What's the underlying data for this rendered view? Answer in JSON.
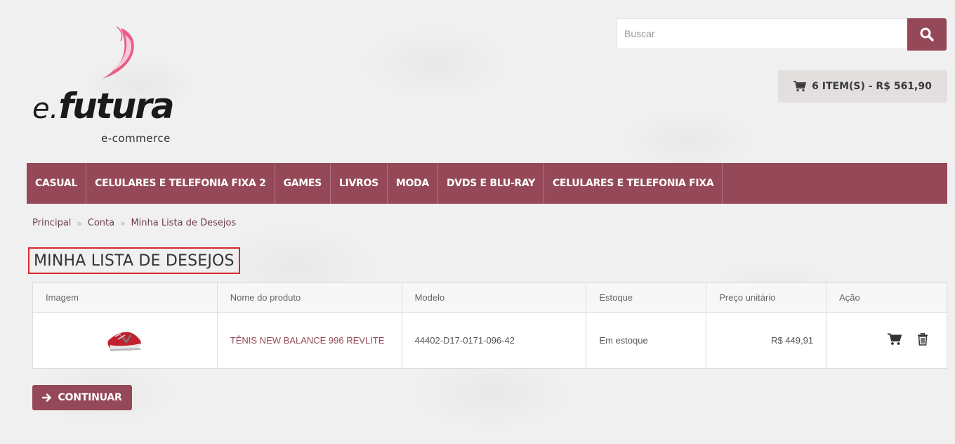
{
  "logo": {
    "prefix": "e.",
    "name": "futura",
    "tagline": "e-commerce"
  },
  "search": {
    "placeholder": "Buscar",
    "icon": "search-icon"
  },
  "cart": {
    "label": "6 ITEM(S) - R$ 561,90",
    "icon": "shopping-cart-icon"
  },
  "nav": {
    "items": [
      "CASUAL",
      "CELULARES E TELEFONIA FIXA 2",
      "GAMES",
      "LIVROS",
      "MODA",
      "DVDS E BLU-RAY",
      "CELULARES E TELEFONIA FIXA"
    ]
  },
  "breadcrumb": {
    "items": [
      "Principal",
      "Conta",
      "Minha Lista de Desejos"
    ],
    "separator": "»"
  },
  "page": {
    "title": "MINHA LISTA DE DESEJOS"
  },
  "table": {
    "headers": [
      "Imagem",
      "Nome do produto",
      "Modelo",
      "Estoque",
      "Preço unitário",
      "Ação"
    ],
    "rows": [
      {
        "image": "red-sneaker-thumbnail",
        "name": "TÊNIS NEW BALANCE 996 REVLITE",
        "model": "44402-D17-0171-096-42",
        "stock": "Em estoque",
        "price": "R$ 449,91",
        "actions": [
          "add-to-cart-icon",
          "trash-icon"
        ]
      }
    ]
  },
  "actions": {
    "continue_label": "CONTINUAR",
    "continue_icon": "arrow-right-icon"
  },
  "colors": {
    "brand": "#954858",
    "cart_bg": "#e3dfdf",
    "highlight": "#d62b2b"
  }
}
